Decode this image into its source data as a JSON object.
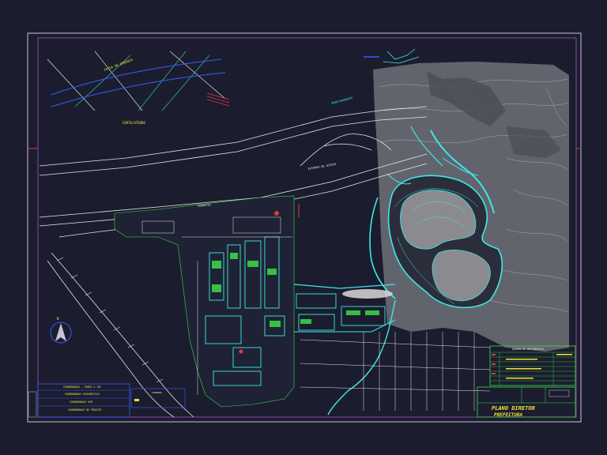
{
  "drawing": {
    "labels": {
      "corridor_top": "FAIXA DE DOMÍNIO",
      "embankment": "CORTE/ATERRO",
      "ferrovia": "FERROVIA",
      "access_road": "ESTRADA DE ACESSO",
      "monitoring": "MONITORAMENTO"
    },
    "coord_block": {
      "line1": "COORDENADAS — PONTO A 101",
      "line2": "COORDENADAS GEOGRÁFICAS",
      "line3": "COORDENADAS UTM",
      "line4": "COORDENADAS DE PROJETO",
      "legend": "LEGENDA"
    },
    "title_block": {
      "header": "QUADRO DE REFERÊNCIAS",
      "title_line1": "PLANO DIRETOR",
      "title_line2": "PREFEITURA"
    },
    "colors": {
      "background": "#1b1d2e",
      "frame": "#c7c2d8",
      "inner_frame": "#b04fc8",
      "cyan": "#3ee8e8",
      "teal": "#2fc0b8",
      "terrain": "#8a8a8a",
      "white_line": "#e6e6e6",
      "yellow": "#f5e23a",
      "red": "#e03a3a",
      "blue": "#3a5cff",
      "green": "#3bdc4a"
    }
  }
}
